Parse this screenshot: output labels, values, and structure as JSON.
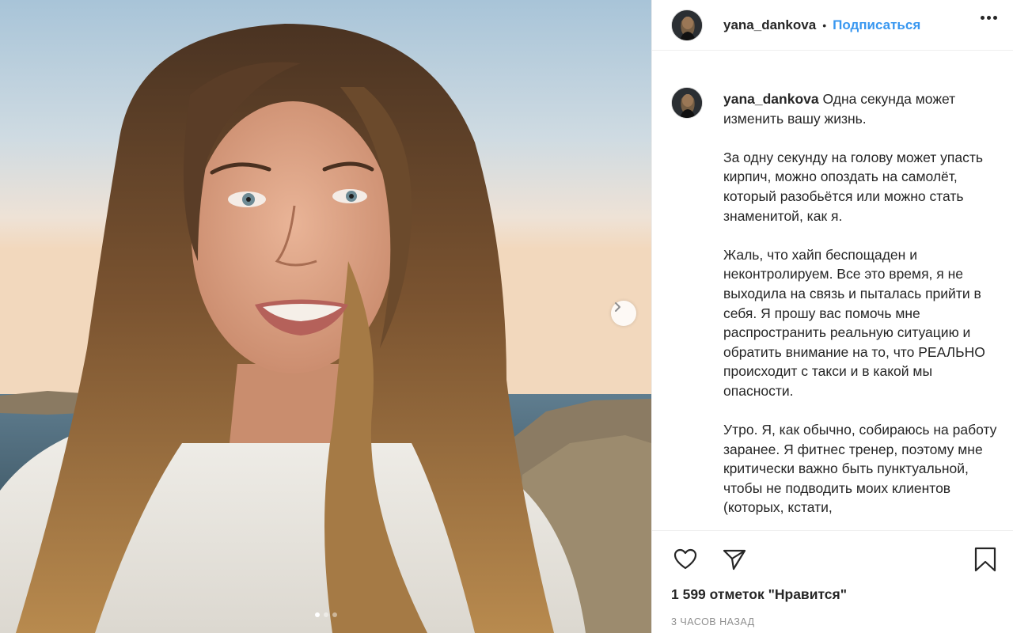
{
  "post": {
    "username": "yana_dankova",
    "separator": "•",
    "follow_label": "Подписаться",
    "caption_paragraphs": [
      "Одна секунда может изменить вашу жизнь.",
      "За одну секунду на голову может упасть кирпич, можно опоздать на самолёт, который разобьётся или можно стать знаменитой, как я.",
      "Жаль, что хайп беспощаден и неконтролируем. Все это время, я не выходила на связь и пыталась прийти в себя. Я прошу вас помочь мне распространить реальную ситуацию и обратить внимание на то, что РЕАЛЬНО происходит с такси и в какой мы опасности.",
      "Утро. Я, как обычно, собираюсь на работу заранее. Я фитнес тренер, поэтому мне критически важно быть пунктуальной, чтобы не подводить моих клиентов (которых, кстати,"
    ],
    "likes_text": "1 599 отметок \"Нравится\"",
    "time_text": "3 часов назад",
    "carousel": {
      "total": 3,
      "active_index": 0
    }
  },
  "icons": {
    "next": "chevron-right-icon",
    "like": "heart-icon",
    "share": "paper-plane-icon",
    "save": "bookmark-icon",
    "more": "more-options-icon"
  },
  "colors": {
    "follow": "#3897f0",
    "text": "#262626",
    "muted": "#8e8e8e",
    "border": "#efefef"
  }
}
